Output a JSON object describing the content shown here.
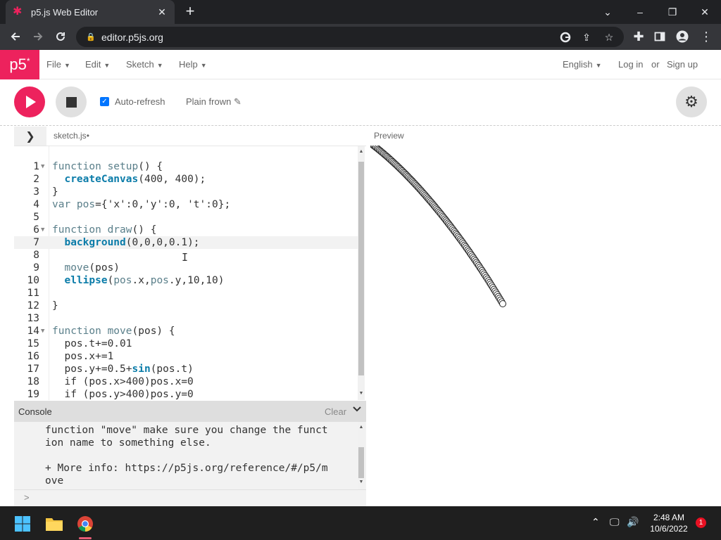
{
  "browser": {
    "tab_title": "p5.js Web Editor",
    "tab_close": "✕",
    "new_tab": "+",
    "url": "editor.p5js.org",
    "window_controls": [
      "⌄",
      "–",
      "❐",
      "✕"
    ]
  },
  "p5": {
    "logo": "p5",
    "logo_sup": "*",
    "menus": [
      {
        "label": "File"
      },
      {
        "label": "Edit"
      },
      {
        "label": "Sketch"
      },
      {
        "label": "Help"
      }
    ],
    "language": "English",
    "login": "Log in",
    "or": "or",
    "signup": "Sign up",
    "auto_refresh": "Auto-refresh",
    "sketch_name": "Plain frown",
    "file_tab": "sketch.js",
    "file_modified": "•",
    "preview_label": "Preview"
  },
  "editor": {
    "lines": [
      {
        "n": "1",
        "fold": true,
        "parts": [
          {
            "t": "function ",
            "c": "kw"
          },
          {
            "t": "setup",
            "c": "kw"
          },
          {
            "t": "() {",
            "c": ""
          }
        ]
      },
      {
        "n": "2",
        "fold": false,
        "parts": [
          {
            "t": "  ",
            "c": ""
          },
          {
            "t": "createCanvas",
            "c": "fn"
          },
          {
            "t": "(400, 400);",
            "c": ""
          }
        ]
      },
      {
        "n": "3",
        "fold": false,
        "parts": [
          {
            "t": "}",
            "c": ""
          }
        ]
      },
      {
        "n": "4",
        "fold": false,
        "parts": [
          {
            "t": "var ",
            "c": "kw"
          },
          {
            "t": "pos",
            "c": "kw"
          },
          {
            "t": "={'x':0,'y':0, 't':0};",
            "c": ""
          }
        ]
      },
      {
        "n": "5",
        "fold": false,
        "parts": [
          {
            "t": "",
            "c": ""
          }
        ]
      },
      {
        "n": "6",
        "fold": true,
        "parts": [
          {
            "t": "function ",
            "c": "kw"
          },
          {
            "t": "draw",
            "c": "kw"
          },
          {
            "t": "() {",
            "c": ""
          }
        ]
      },
      {
        "n": "7",
        "fold": false,
        "active": true,
        "parts": [
          {
            "t": "  ",
            "c": ""
          },
          {
            "t": "background",
            "c": "fn"
          },
          {
            "t": "(0,0,0,0.1);",
            "c": ""
          }
        ]
      },
      {
        "n": "8",
        "fold": false,
        "parts": [
          {
            "t": "",
            "c": ""
          }
        ]
      },
      {
        "n": "9",
        "fold": false,
        "parts": [
          {
            "t": "  ",
            "c": ""
          },
          {
            "t": "move",
            "c": "kw"
          },
          {
            "t": "(pos)",
            "c": ""
          }
        ]
      },
      {
        "n": "10",
        "fold": false,
        "parts": [
          {
            "t": "  ",
            "c": ""
          },
          {
            "t": "ellipse",
            "c": "fn"
          },
          {
            "t": "(",
            "c": ""
          },
          {
            "t": "pos",
            "c": "kw"
          },
          {
            "t": ".x,",
            "c": ""
          },
          {
            "t": "pos",
            "c": "kw"
          },
          {
            "t": ".y,10,10)",
            "c": ""
          }
        ]
      },
      {
        "n": "11",
        "fold": false,
        "parts": [
          {
            "t": "",
            "c": ""
          }
        ]
      },
      {
        "n": "12",
        "fold": false,
        "parts": [
          {
            "t": "}",
            "c": ""
          }
        ]
      },
      {
        "n": "13",
        "fold": false,
        "parts": [
          {
            "t": "",
            "c": ""
          }
        ]
      },
      {
        "n": "14",
        "fold": true,
        "parts": [
          {
            "t": "function ",
            "c": "kw"
          },
          {
            "t": "move",
            "c": "kw"
          },
          {
            "t": "(pos) {",
            "c": ""
          }
        ]
      },
      {
        "n": "15",
        "fold": false,
        "parts": [
          {
            "t": "  pos.t+=0.01",
            "c": ""
          }
        ]
      },
      {
        "n": "16",
        "fold": false,
        "parts": [
          {
            "t": "  pos.x+=1",
            "c": ""
          }
        ]
      },
      {
        "n": "17",
        "fold": false,
        "parts": [
          {
            "t": "  pos.y+=0.5+",
            "c": ""
          },
          {
            "t": "sin",
            "c": "fn"
          },
          {
            "t": "(pos.t)",
            "c": ""
          }
        ]
      },
      {
        "n": "18",
        "fold": false,
        "parts": [
          {
            "t": "  if (pos.x>400)pos.x=0",
            "c": ""
          }
        ]
      },
      {
        "n": "19",
        "fold": false,
        "parts": [
          {
            "t": "  if (pos.y>400)pos.y=0",
            "c": ""
          }
        ]
      }
    ]
  },
  "console": {
    "label": "Console",
    "clear": "Clear",
    "lines": [
      "function \"move\" make sure you change the funct",
      "ion name to something else.",
      "",
      "+ More info: https://p5js.org/reference/#/p5/m",
      "ove"
    ],
    "prompt": ">"
  },
  "taskbar": {
    "time": "2:48 AM",
    "date": "10/6/2022",
    "notifications": "1"
  }
}
